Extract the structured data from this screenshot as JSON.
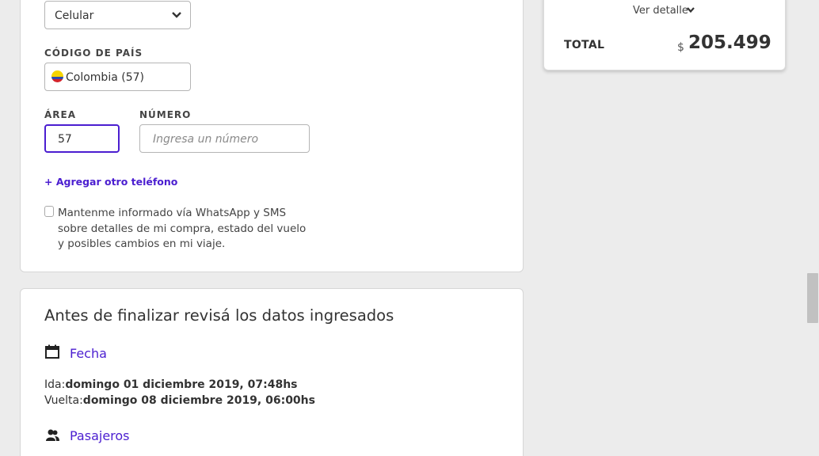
{
  "contact": {
    "phone_type": {
      "value": "Celular",
      "icon": "chevron-down-icon"
    },
    "country_code": {
      "label": "CÓDIGO DE PAÍS",
      "value": "Colombia (57)",
      "flag": "colombia-flag-icon"
    },
    "area": {
      "label": "ÁREA",
      "value": "57"
    },
    "number": {
      "label": "NÚMERO",
      "placeholder": "Ingresa un número"
    },
    "add_phone": "+ Agregar otro teléfono",
    "whatsapp_optin": "Mantenme informado vía WhatsApp y SMS sobre detalles de mi compra, estado del vuelo y posibles cambios en mi viaje."
  },
  "review": {
    "title": "Antes de finalizar revisá los datos ingresados",
    "fecha": {
      "title": "Fecha",
      "icon": "calendar-icon",
      "ida_label": "Ida:",
      "ida_value": "domingo 01 diciembre 2019, 07:48hs",
      "vuelta_label": "Vuelta:",
      "vuelta_value": "domingo 08 diciembre 2019, 06:00hs"
    },
    "pasajeros": {
      "title": "Pasajeros",
      "icon": "people-icon"
    }
  },
  "summary": {
    "ver_detalle": "Ver detalle",
    "total_label": "TOTAL",
    "currency": "$",
    "amount": "205.499"
  },
  "colors": {
    "accent": "#4b1ed0",
    "background": "#ececec"
  }
}
